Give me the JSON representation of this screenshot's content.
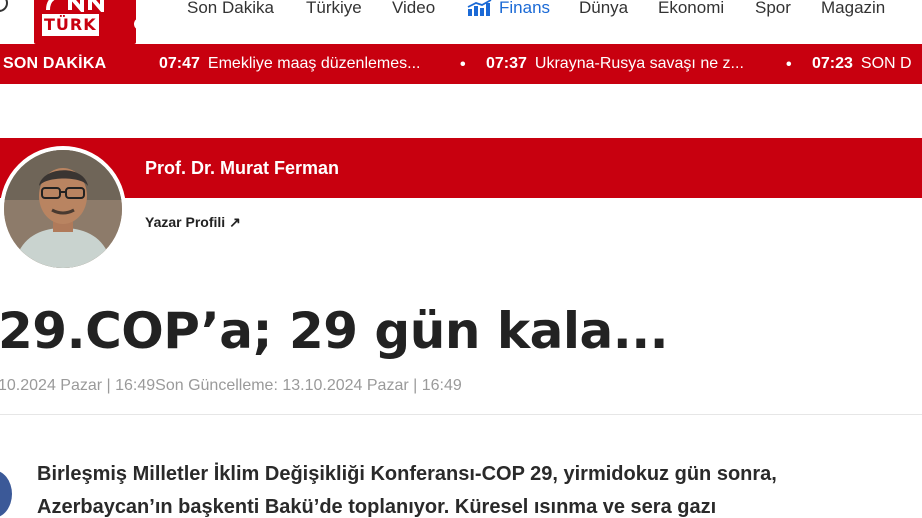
{
  "brand": {
    "logo_text": "TÜRK",
    "logo_suffix": "com",
    "brand_color": "#c8000f",
    "accent_link_color": "#1b6ad6"
  },
  "nav": {
    "items": [
      {
        "label": "Son Dakika"
      },
      {
        "label": "Türkiye"
      },
      {
        "label": "Video"
      },
      {
        "label": "Finans",
        "icon": "finance-chart-icon"
      },
      {
        "label": "Dünya"
      },
      {
        "label": "Ekonomi"
      },
      {
        "label": "Spor"
      },
      {
        "label": "Magazin"
      }
    ]
  },
  "breaking": {
    "label": "SON DAKİKA",
    "items": [
      {
        "time": "07:47",
        "text": "Emekliye maaş düzenlemes..."
      },
      {
        "time": "07:37",
        "text": "Ukrayna-Rusya savaşı ne z..."
      },
      {
        "time": "07:23",
        "text": "SON D"
      }
    ]
  },
  "author": {
    "name": "Prof. Dr. Murat Ferman",
    "profile_link": "Yazar Profili"
  },
  "article": {
    "title": "29.COP’a; 29 gün kala...",
    "meta": "10.2024 Pazar | 16:49Son Güncelleme: 13.10.2024 Pazar | 16:49",
    "lead_line1": "Birleşmiş Milletler İklim Değişikliği Konferansı-COP 29, yirmidokuz gün sonra,",
    "lead_line2": "Azerbaycan’ın başkenti Bakü’de toplanıyor. Küresel ısınma ve sera gazı"
  }
}
